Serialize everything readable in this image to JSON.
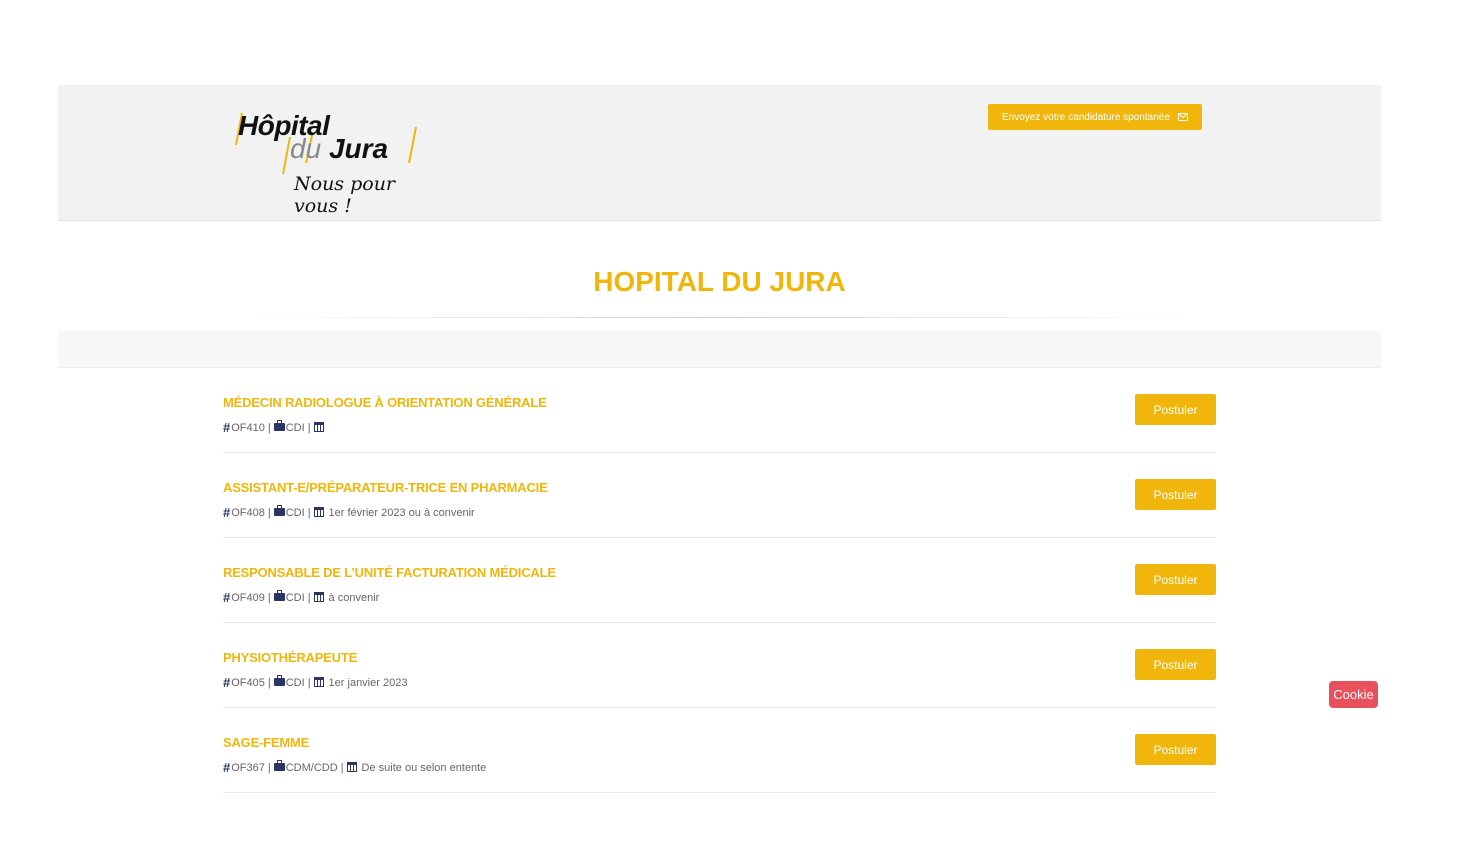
{
  "header": {
    "logo": {
      "line1": "Hôpital",
      "line2_du": "du",
      "line2_jura": "Jura",
      "tagline": "Nous pour vous !"
    },
    "spontaneous_button": {
      "label": "Envoyez votre candidature spontanée",
      "icon": "envelope-icon"
    }
  },
  "page": {
    "title": "HOPITAL DU JURA"
  },
  "jobs": [
    {
      "title": "MÉDECIN RADIOLOGUE À ORIENTATION GÉNÉRALE",
      "ref": "OF410",
      "contract": "CDI",
      "start": "",
      "button": "Postuler"
    },
    {
      "title": "ASSISTANT-E/PRÉPARATEUR-TRICE EN PHARMACIE",
      "ref": "OF408",
      "contract": "CDI",
      "start": "1er février 2023 ou à convenir",
      "button": "Postuler"
    },
    {
      "title": "RESPONSABLE DE L’UNITÉ FACTURATION MÉDICALE",
      "ref": "OF409",
      "contract": "CDI",
      "start": "à convenir",
      "button": "Postuler"
    },
    {
      "title": "PHYSIOTHÉRAPEUTE",
      "ref": "OF405",
      "contract": "CDI",
      "start": "1er janvier 2023",
      "button": "Postuler"
    },
    {
      "title": "SAGE-FEMME",
      "ref": "OF367",
      "contract": "CDM/CDD",
      "start": "De suite ou selon entente",
      "button": "Postuler"
    }
  ],
  "meta_separator": "|",
  "cookie": {
    "label": "Cookie"
  },
  "colors": {
    "accent": "#f0b60c",
    "icon": "#2b3466",
    "cookie": "#e8505b",
    "header_bg": "#f2f2f2"
  }
}
